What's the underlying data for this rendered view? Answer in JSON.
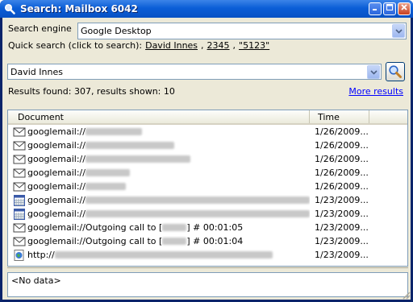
{
  "window": {
    "title": "Search: Mailbox 6042"
  },
  "engine": {
    "label": "Search engine",
    "selected": "Google Desktop"
  },
  "quick": {
    "label": "Quick search (click to search):",
    "links": [
      "David Innes",
      "2345",
      "\"5123\""
    ]
  },
  "search": {
    "value": "David Innes"
  },
  "results": {
    "summary": "Results found: 307, results shown: 10",
    "more_label": "More results"
  },
  "table": {
    "headers": {
      "document": "Document",
      "time": "Time"
    },
    "rows": [
      {
        "icon": "email-icon",
        "prefix": "googlemail://",
        "text": "",
        "time": "1/26/2009..."
      },
      {
        "icon": "email-icon",
        "prefix": "googlemail://",
        "text": "",
        "time": "1/26/2009..."
      },
      {
        "icon": "email-icon",
        "prefix": "googlemail://",
        "text": "",
        "time": "1/26/2009..."
      },
      {
        "icon": "email-icon",
        "prefix": "googlemail://",
        "text": "",
        "time": "1/26/2009..."
      },
      {
        "icon": "email-icon",
        "prefix": "googlemail://",
        "text": "",
        "time": "1/26/2009..."
      },
      {
        "icon": "calendar-icon",
        "prefix": "googlemail://",
        "text": "",
        "time": "1/23/2009..."
      },
      {
        "icon": "calendar-icon",
        "prefix": "googlemail://",
        "text": "",
        "time": "1/23/2009..."
      },
      {
        "icon": "email-icon",
        "prefix": "googlemail://Outgoing call to [",
        "text": "] # 00:01:05",
        "time": "1/23/2009..."
      },
      {
        "icon": "email-icon",
        "prefix": "googlemail://Outgoing call to [",
        "text": "] # 00:01:04",
        "time": "1/23/2009..."
      },
      {
        "icon": "web-page-icon",
        "prefix": "http://",
        "text": "",
        "time": "1/23/2009..."
      }
    ]
  },
  "status": {
    "text": "<No data>"
  }
}
